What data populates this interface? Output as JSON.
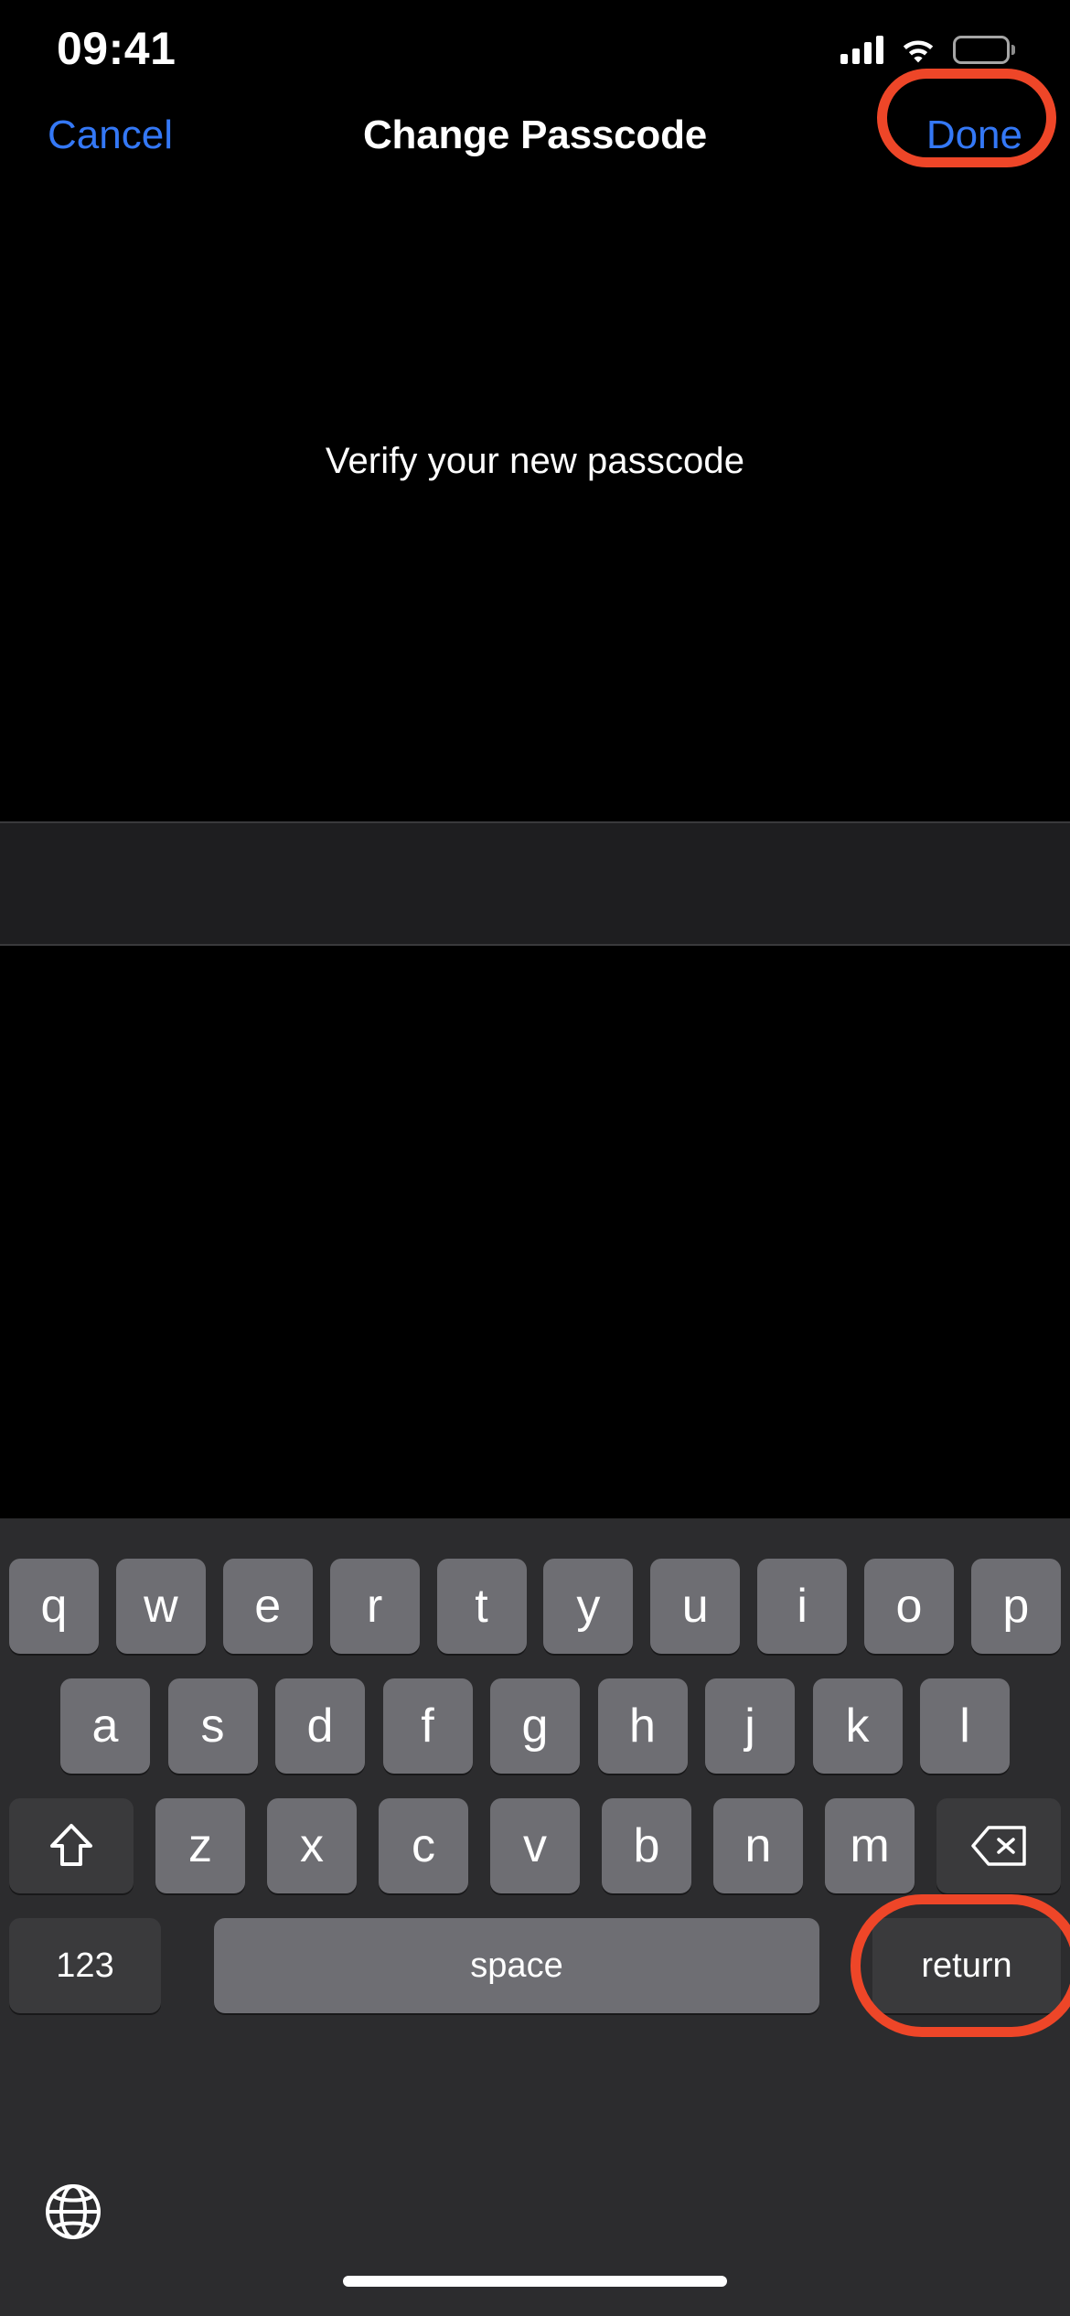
{
  "status_bar": {
    "time": "09:41",
    "cellular_icon": "cellular-signal-icon",
    "wifi_icon": "wifi-icon",
    "battery_icon": "battery-icon"
  },
  "nav_bar": {
    "cancel_label": "Cancel",
    "title": "Change Passcode",
    "done_label": "Done"
  },
  "main": {
    "prompt": "Verify your new passcode",
    "passcode_value": "",
    "passcode_placeholder": ""
  },
  "keyboard": {
    "row1": [
      "q",
      "w",
      "e",
      "r",
      "t",
      "y",
      "u",
      "i",
      "o",
      "p"
    ],
    "row2": [
      "a",
      "s",
      "d",
      "f",
      "g",
      "h",
      "j",
      "k",
      "l"
    ],
    "row3_letters": [
      "z",
      "x",
      "c",
      "v",
      "b",
      "n",
      "m"
    ],
    "shift_icon": "shift-icon",
    "backspace_icon": "backspace-icon",
    "numbers_label": "123",
    "space_label": "space",
    "return_label": "return",
    "globe_icon": "globe-icon"
  },
  "annotations": {
    "color": "#EE4628",
    "targets": [
      "Done",
      "return"
    ]
  },
  "colors": {
    "background": "#000000",
    "accent_blue": "#3478F6",
    "keyboard_background": "#2C2C2E",
    "key_light": "#6E6E73",
    "key_dark": "#3A3A3C",
    "field_background": "#1E1E20",
    "annotation_red": "#EE4628"
  }
}
